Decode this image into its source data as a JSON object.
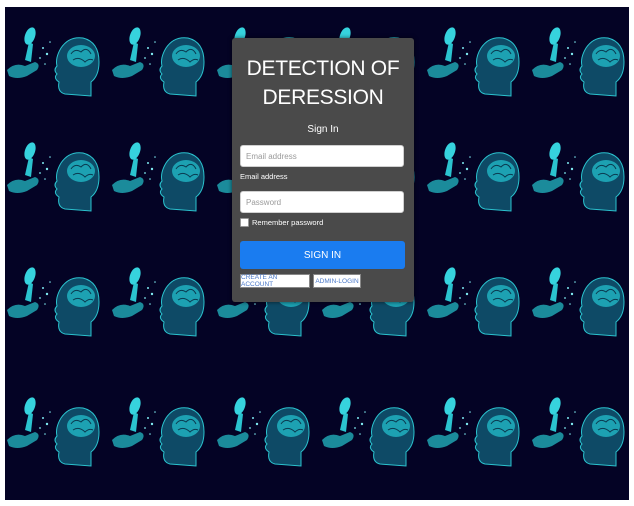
{
  "form": {
    "title_line1": "DETECTION OF",
    "title_line2": "DERESSION",
    "subtitle": "Sign In",
    "email_placeholder": "Email address",
    "email_label": "Email address",
    "password_placeholder": "Password",
    "remember_label": "Remember password",
    "sign_in_button": "SIGN IN",
    "create_account_button": "CREATE AN ACCOUNT",
    "admin_login_button": "ADMIN-LOGIN"
  },
  "colors": {
    "background": "#040325",
    "card": "#4a4a4a",
    "primary_button": "#1a7cf0",
    "artwork": "#26b8c8"
  },
  "icons": {
    "background_pattern": "head-brain-hand-illustration"
  }
}
